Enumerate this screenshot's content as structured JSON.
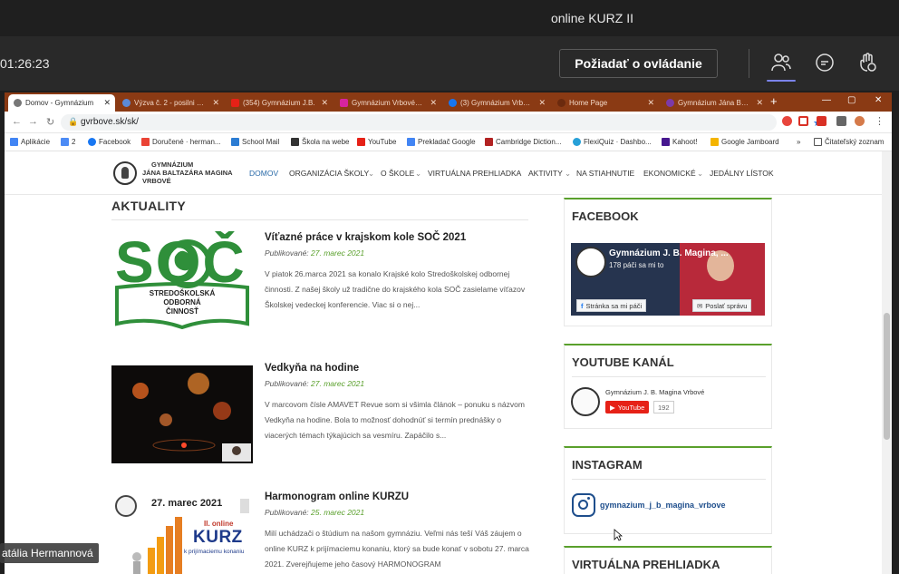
{
  "teams": {
    "meeting_title": "online KURZ II",
    "timer": "01:26:23",
    "request_control": "Požiadať o ovládanie",
    "participant_name": "atália Hermannová"
  },
  "browser": {
    "tabs": [
      {
        "label": "Domov - Gymnázium",
        "color": "#777"
      },
      {
        "label": "Výzva č. 2 - posilni odb",
        "color": "#5b8ad8"
      },
      {
        "label": "(354) Gymnázium J.B.",
        "color": "#e62117"
      },
      {
        "label": "Gymnázium Vrbové (G",
        "color": "#d6249f"
      },
      {
        "label": "(3) Gymnázium Vrbové",
        "color": "#1877f2"
      },
      {
        "label": "Home Page",
        "color": "#8a3a14"
      },
      {
        "label": "Gymnázium Jána Baltá",
        "color": "#7c3aa8"
      }
    ],
    "url": "gvrbove.sk/sk/",
    "bookmarks": [
      {
        "label": "Aplikácie",
        "color": "#4285f4"
      },
      {
        "label": "2",
        "color": "#4c8bf5"
      },
      {
        "label": "Facebook",
        "color": "#1877f2"
      },
      {
        "label": "Doručené · herman...",
        "color": "#ea4335"
      },
      {
        "label": "School Mail",
        "color": "#2b7cd3"
      },
      {
        "label": "Škola na webe",
        "color": "#333"
      },
      {
        "label": "YouTube",
        "color": "#e62117"
      },
      {
        "label": "Prekladač Google",
        "color": "#4285f4"
      },
      {
        "label": "Cambridge Diction...",
        "color": "#b22222"
      },
      {
        "label": "FlexiQuiz · Dashbo...",
        "color": "#27a0d8"
      },
      {
        "label": "Kahoot!",
        "color": "#46178f"
      },
      {
        "label": "Google Jamboard",
        "color": "#f4b400"
      }
    ],
    "reading_list": "Čitateľský zoznam"
  },
  "site": {
    "logo": {
      "line1": "GYMNÁZIUM",
      "line2": "JÁNA BALTAZÁRA MAGINA",
      "line3": "VRBOVÉ"
    },
    "nav": [
      "DOMOV",
      "ORGANIZÁCIA ŠKOLY",
      "O ŠKOLE",
      "VIRTUÁLNA PREHLIADKA",
      "AKTIVITY",
      "NA STIAHNUTIE",
      "EKONOMICKÉ",
      "JEDÁLNY LÍSTOK"
    ],
    "section_title": "AKTUALITY",
    "published_label": "Publikované:",
    "posts": [
      {
        "title": "Víťazné práce v krajskom kole SOČ 2021",
        "date": "27. marec 2021",
        "text": "V piatok 26.marca 2021 sa konalo Krajské kolo Stredoškolskej odbornej činnosti. Z našej školy už tradične do krajského kola SOČ zasielame víťazov Školskej vedeckej konferencie. Viac si o nej...",
        "image": {
          "letters": "SOČ",
          "line1": "STREDOŠKOLSKÁ",
          "line2": "ODBORNÁ",
          "line3": "ČINNOSŤ"
        }
      },
      {
        "title": "Vedkyňa na hodine",
        "date": "27. marec 2021",
        "text": "V marcovom čísle AMAVET Revue som si všimla článok – ponuku s názvom Vedkyňa na hodine. Bola to možnosť dohodnúť si termín prednášky o viacerých témach týkajúcich sa vesmíru. Zapáčilo s..."
      },
      {
        "title": "Harmonogram online KURZU",
        "date": "25. marec 2021",
        "text": "Milí uchádzači o štúdium na našom gymnáziu. Veľmi nás teší Váš záujem o online KURZ k prijímaciemu konaniu, ktorý sa bude konať v sobotu 27. marca 2021. Zverejňujeme jeho časový HARMONOGRAM",
        "image": {
          "date": "27. marec 2021",
          "title_top": "II. online",
          "title_main": "KURZ",
          "subtitle": "k prijímaciemu konaniu"
        }
      }
    ],
    "sidebar": {
      "facebook": {
        "title": "FACEBOOK",
        "page_name": "Gymnázium J. B. Magina, ...",
        "likes": "178 páči sa mi to",
        "like_button": "Stránka sa mi páči",
        "message_button": "Poslať správu"
      },
      "youtube": {
        "title": "YOUTUBE KANÁL",
        "channel": "Gymnázium J. B. Magina Vrbové",
        "button": "YouTube",
        "count": "192"
      },
      "instagram": {
        "title": "INSTAGRAM",
        "handle": "gymnazium_j_b_magina_vrbove"
      },
      "virtual_tour": {
        "title": "VIRTUÁLNA PREHLIADKA"
      }
    }
  }
}
